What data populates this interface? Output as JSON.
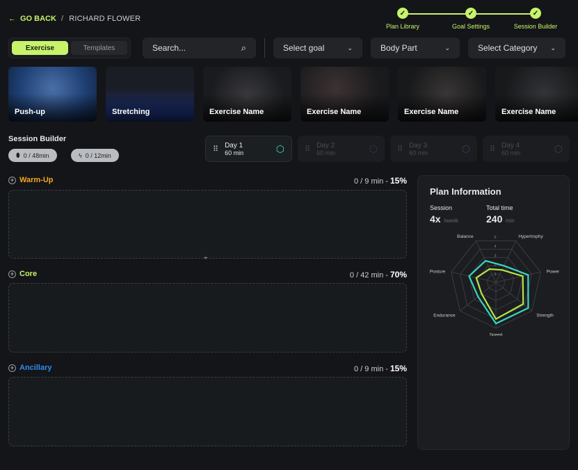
{
  "header": {
    "back_label": "GO BACK",
    "breadcrumb": "RICHARD FLOWER",
    "steps": [
      {
        "label": "Plan Library",
        "done": true
      },
      {
        "label": "Goal Settings",
        "done": true
      },
      {
        "label": "Session Builder",
        "done": true
      }
    ]
  },
  "toolbar": {
    "tabs": [
      {
        "label": "Exercise",
        "active": true
      },
      {
        "label": "Templates",
        "active": false
      }
    ],
    "search_placeholder": "Search...",
    "goal": "Select goal",
    "body_part": "Body Part",
    "category": "Select Category"
  },
  "exercises": [
    {
      "name": "Push-up"
    },
    {
      "name": "Stretching"
    },
    {
      "name": "Exercise Name"
    },
    {
      "name": "Exercise Name"
    },
    {
      "name": "Exercise Name"
    },
    {
      "name": "Exercise Name"
    }
  ],
  "session": {
    "title": "Session Builder",
    "pills": [
      {
        "icon": "shield-icon",
        "text": "0 / 48min"
      },
      {
        "icon": "bolt-icon",
        "text": "0 / 12min"
      }
    ],
    "days": [
      {
        "label": "Day 1",
        "duration": "60 min",
        "active": true
      },
      {
        "label": "Day 2",
        "duration": "60 min",
        "active": false
      },
      {
        "label": "Day 3",
        "duration": "60 min",
        "active": false
      },
      {
        "label": "Day 4",
        "duration": "60 min",
        "active": false
      }
    ]
  },
  "sections": [
    {
      "title": "Warm-Up",
      "stat": "0 / 9 min - ",
      "pct": "15%",
      "color": "#f5a623"
    },
    {
      "title": "Core",
      "stat": "0 / 42 min - ",
      "pct": "70%",
      "color": "#c7f36b"
    },
    {
      "title": "Ancillary",
      "stat": "0 / 9 min - ",
      "pct": "15%",
      "color": "#2d8cf0"
    }
  ],
  "plan": {
    "title": "Plan Information",
    "session_label": "Session",
    "session_value": "4x",
    "session_unit": "/week",
    "time_label": "Total time",
    "time_value": "240",
    "time_unit": "min"
  },
  "chart_data": {
    "type": "radar",
    "axes": [
      "Speed",
      "Strength",
      "Power",
      "Hypertrophy",
      "Balance",
      "Posture",
      "Endurance"
    ],
    "range": [
      0,
      5
    ],
    "ticks": [
      "1",
      "2",
      "3",
      "4",
      "5"
    ],
    "series": [
      {
        "color": "#3ad6c0",
        "values": [
          4.5,
          4.5,
          3.6,
          2.0,
          2.6,
          3.0,
          2.5
        ]
      },
      {
        "color": "#b5e34a",
        "values": [
          4.0,
          3.8,
          3.0,
          1.5,
          1.6,
          2.2,
          2.0
        ]
      }
    ]
  }
}
